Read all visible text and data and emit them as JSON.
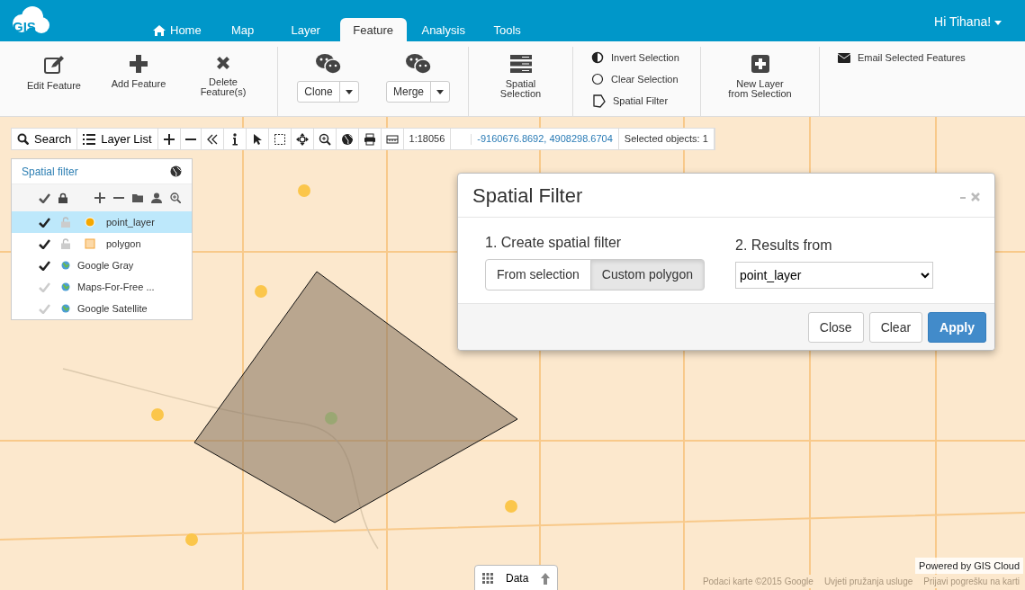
{
  "header": {
    "logo": "GIS",
    "tabs": [
      {
        "label": "Home",
        "selected": false
      },
      {
        "label": "Map",
        "selected": false
      },
      {
        "label": "Layer",
        "selected": false
      },
      {
        "label": "Feature",
        "selected": true
      },
      {
        "label": "Analysis",
        "selected": false
      },
      {
        "label": "Tools",
        "selected": false
      }
    ],
    "user": "Hi Tihana!"
  },
  "ribbon": [
    {
      "items": [
        {
          "kind": "big",
          "label": "Edit Feature"
        },
        {
          "kind": "big",
          "label": "Add Feature"
        },
        {
          "kind": "big",
          "label": "Delete Feature(s)"
        }
      ]
    },
    {
      "items": [
        {
          "kind": "split",
          "label": "Clone"
        },
        {
          "kind": "split",
          "label": "Merge"
        }
      ]
    },
    {
      "items": [
        {
          "kind": "big",
          "label": "Spatial Selection"
        }
      ]
    },
    {
      "items": [
        {
          "kind": "list",
          "label": "Invert Selection"
        },
        {
          "kind": "list",
          "label": "Clear Selection"
        },
        {
          "kind": "list",
          "label": "Spatial Filter"
        }
      ]
    },
    {
      "items": [
        {
          "kind": "big",
          "label": "New Layer from Selection"
        }
      ]
    },
    {
      "items": [
        {
          "kind": "list",
          "label": "Email Selected Features"
        }
      ]
    }
  ],
  "map_toolbar": {
    "search": "Search",
    "layer_list": "Layer List",
    "scale": "1:18056",
    "coordinates": "-9160676.8692, 4908298.6704",
    "selected_objects": "Selected objects: 1"
  },
  "layer_panel": {
    "title": "Spatial filter",
    "layers": [
      {
        "name": "point_layer",
        "visible": true,
        "selected": true,
        "kind": "point"
      },
      {
        "name": "polygon",
        "visible": true,
        "selected": false,
        "kind": "polygon"
      },
      {
        "name": "Google Gray",
        "visible": true,
        "selected": false,
        "kind": "basemap"
      },
      {
        "name": "Maps-For-Free ...",
        "visible": false,
        "selected": false,
        "kind": "basemap"
      },
      {
        "name": "Google Satellite",
        "visible": false,
        "selected": false,
        "kind": "basemap"
      }
    ]
  },
  "dialog": {
    "title": "Spatial Filter",
    "step1": "1. Create spatial filter",
    "modes": [
      {
        "label": "From selection",
        "selected": false
      },
      {
        "label": "Custom polygon",
        "selected": true
      }
    ],
    "step2": "2. Results from",
    "results_from": "point_layer",
    "buttons": [
      {
        "label": "Close",
        "kind": "default"
      },
      {
        "label": "Clear",
        "kind": "default"
      },
      {
        "label": "Apply",
        "kind": "primary"
      }
    ]
  },
  "data_tab": "Data",
  "attribution": [
    "Podaci karte ©2015 Google",
    "Uvjeti pružanja usluge",
    "Prijavi pogrešku na karti"
  ],
  "powered_by": "Powered by GIS Cloud"
}
